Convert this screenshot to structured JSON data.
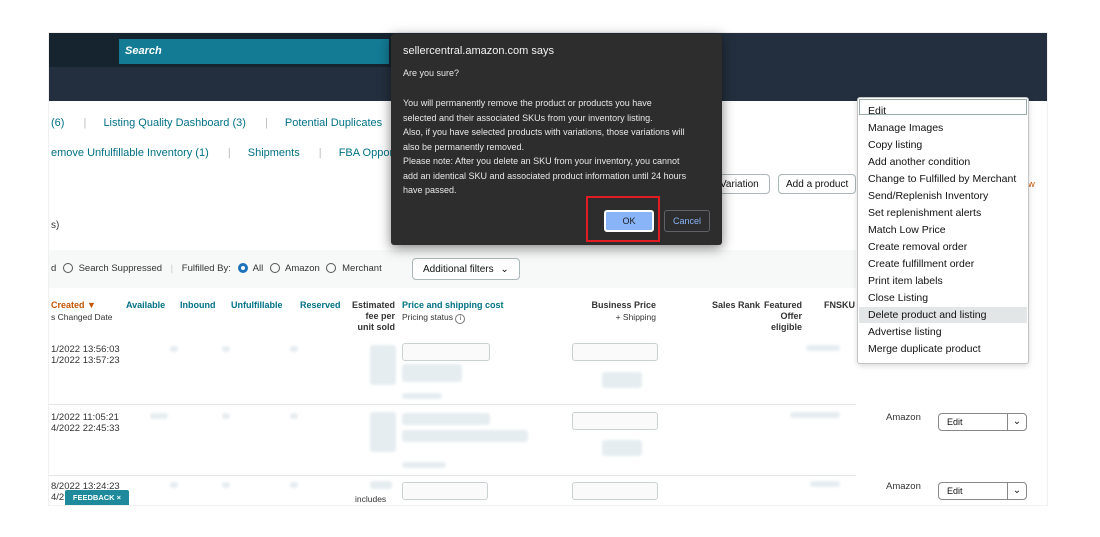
{
  "search": {
    "label": "Search"
  },
  "nav": {
    "row1": [
      "(6)",
      "Listing Quality Dashboard (3)",
      "Potential Duplicates"
    ],
    "row2": [
      "emove Unfulfillable Inventory (1)",
      "Shipments",
      "FBA Opportun"
    ]
  },
  "count_fragment": "s)",
  "buttons": {
    "variation": "Variation",
    "add_product": "Add a product",
    "orange_link": "w"
  },
  "filters": {
    "prefix": "d",
    "search_suppressed": "Search Suppressed",
    "fulfilled_by": "Fulfilled By:",
    "all": "All",
    "amazon": "Amazon",
    "merchant": "Merchant",
    "additional": "Additional filters"
  },
  "columns": {
    "created": "Created",
    "changed": "s Changed Date",
    "available": "Available",
    "inbound": "Inbound",
    "unfulfillable": "Unfulfillable",
    "reserved": "Reserved",
    "fee": [
      "Estimated",
      "fee per",
      "unit sold"
    ],
    "price": "Price and shipping cost",
    "pricing_status": "Pricing status",
    "business_price": "Business Price",
    "shipping": "+ Shipping",
    "sales_rank": "Sales Rank",
    "featured": [
      "Featured",
      "Offer",
      "eligible"
    ],
    "fnsku": "FNSKU"
  },
  "rows": [
    {
      "created": "1/2022 13:56:03",
      "changed": "1/2022 13:57:23",
      "fulfilled": "",
      "action": ""
    },
    {
      "created": "1/2022 11:05:21",
      "changed": "4/2022 22:45:33",
      "fulfilled": "Amazon",
      "action": "Edit"
    },
    {
      "created": "8/2022 13:24:23",
      "changed": "4/2",
      "fulfilled": "Amazon",
      "action": "Edit"
    }
  ],
  "row3_fragment": "includes",
  "feedback": "FEEDBACK ×",
  "dialog": {
    "host": "sellercentral.amazon.com says",
    "question": "Are you sure?",
    "lines": [
      "You will permanently remove the product or products you have",
      "selected and their associated SKUs from your inventory listing.",
      "Also, if you have selected products with variations, those variations will",
      "also be permanently removed.",
      "Please note: After you delete an SKU from your inventory, you cannot",
      "add an identical SKU and associated product information until 24 hours",
      "have passed."
    ],
    "ok": "OK",
    "cancel": "Cancel"
  },
  "menu": {
    "items": [
      "Edit",
      "Manage Images",
      "Copy listing",
      "Add another condition",
      "Change to Fulfilled by Merchant",
      "Send/Replenish Inventory",
      "Set replenishment alerts",
      "Match Low Price",
      "Create removal order",
      "Create fulfillment order",
      "Print item labels",
      "Close Listing",
      "Delete product and listing",
      "Advertise listing",
      "Merge duplicate product"
    ],
    "highlighted_index": 12
  },
  "colors": {
    "dialog_bg": "#2d2d2e",
    "ok_bg": "#8ab4f8",
    "highlight_box": "#e31b23",
    "link": "#007185",
    "topbar": "#232f3e"
  }
}
